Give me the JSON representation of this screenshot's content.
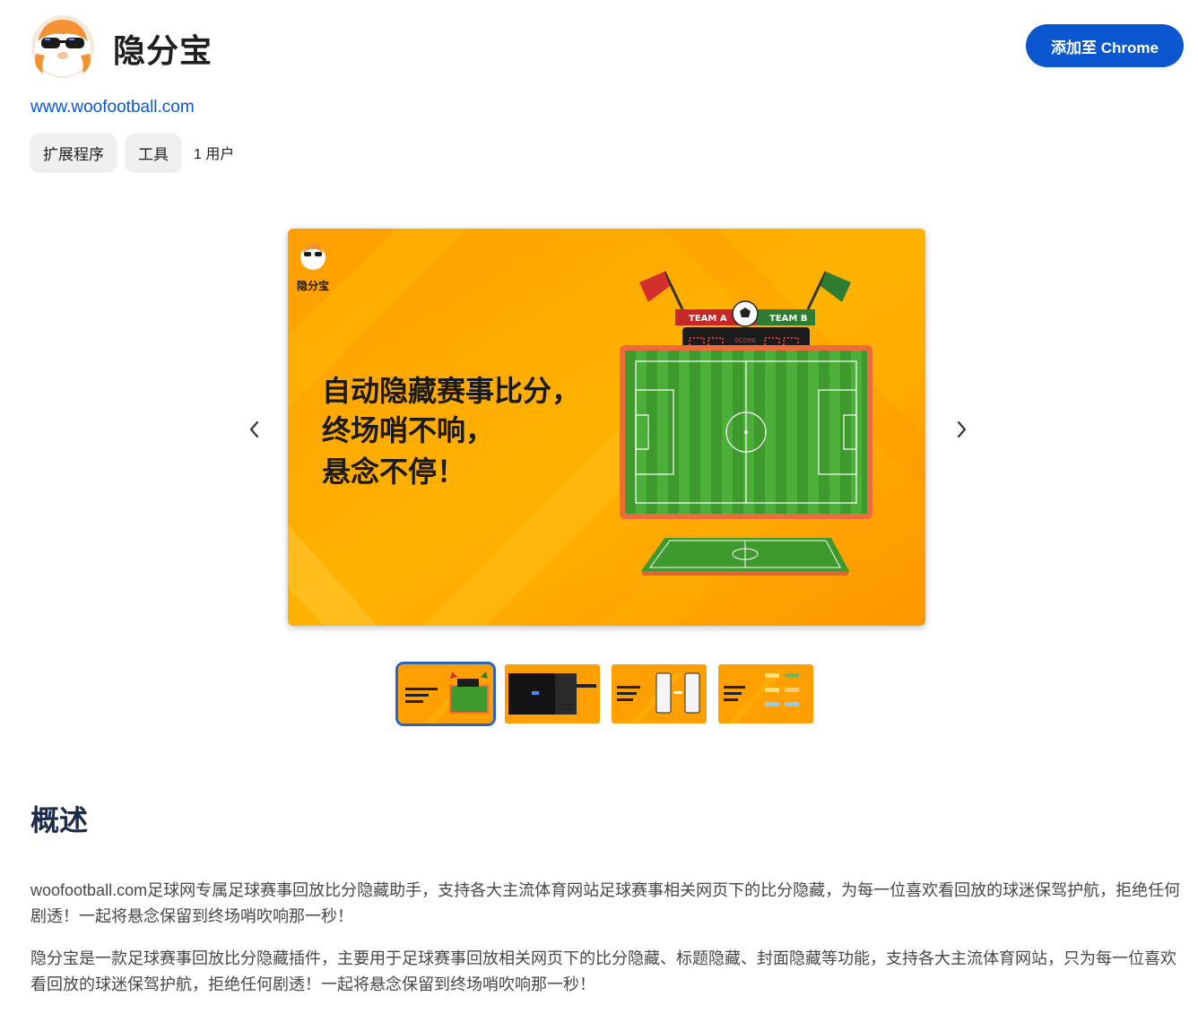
{
  "header": {
    "title": "隐分宝",
    "add_button_label": "添加至 Chrome"
  },
  "site": {
    "link_text": "www.woofootball.com"
  },
  "chips": [
    {
      "label": "扩展程序"
    },
    {
      "label": "工具"
    }
  ],
  "users_text": "1 用户",
  "carousel": {
    "logo_text": "隐分宝",
    "headline": [
      "自动隐藏赛事比分，",
      "终场哨不响，",
      "悬念不停！"
    ],
    "team_a": "TEAM A",
    "team_b": "TEAM B",
    "score_label": "SCORE",
    "active_index": 0,
    "count": 4
  },
  "overview": {
    "title": "概述",
    "paragraphs": [
      "woofootball.com足球网专属足球赛事回放比分隐藏助手，支持各大主流体育网站足球赛事相关网页下的比分隐藏，为每一位喜欢看回放的球迷保驾护航，拒绝任何剧透！一起将悬念保留到终场哨吹响那一秒！",
      "隐分宝是一款足球赛事回放比分隐藏插件，主要用于足球赛事回放相关网页下的比分隐藏、标题隐藏、封面隐藏等功能，支持各大主流体育网站，只为每一位喜欢看回放的球迷保驾护航，拒绝任何剧透！一起将悬念保留到终场哨吹响那一秒！"
    ]
  },
  "colors": {
    "accent": "#0b57d0",
    "banner_orange": "#ffa000",
    "pitch_green": "#3e9a2c"
  },
  "icons": [
    "mascot-logo",
    "chevron-left-icon",
    "chevron-right-icon",
    "soccer-ball-icon",
    "flag-icon"
  ]
}
